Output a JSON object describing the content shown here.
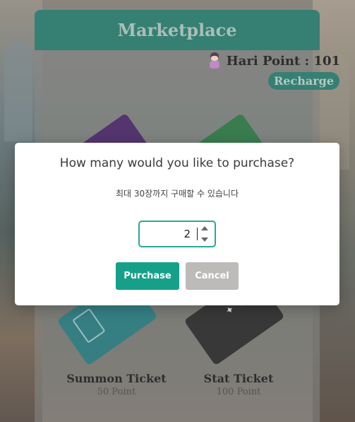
{
  "marketplace": {
    "title": "Marketplace",
    "points_label": "Hari Point : 101",
    "recharge_label": "Recharge"
  },
  "tickets": [
    {
      "name": "Summon Ticket",
      "price": "50 Point",
      "color": "#1a6e72"
    },
    {
      "name": "Stat Ticket",
      "price": "100 Point",
      "color": "#1d1d1d"
    }
  ],
  "modal": {
    "title": "How many would you like to purchase?",
    "subtitle": "최대 30장까지 구매할 수 있습니다",
    "quantity": "2",
    "purchase_label": "Purchase",
    "cancel_label": "Cancel"
  },
  "colors": {
    "accent": "#1b6e60",
    "purchase": "#16a08a",
    "cancel": "#bdbaba"
  }
}
